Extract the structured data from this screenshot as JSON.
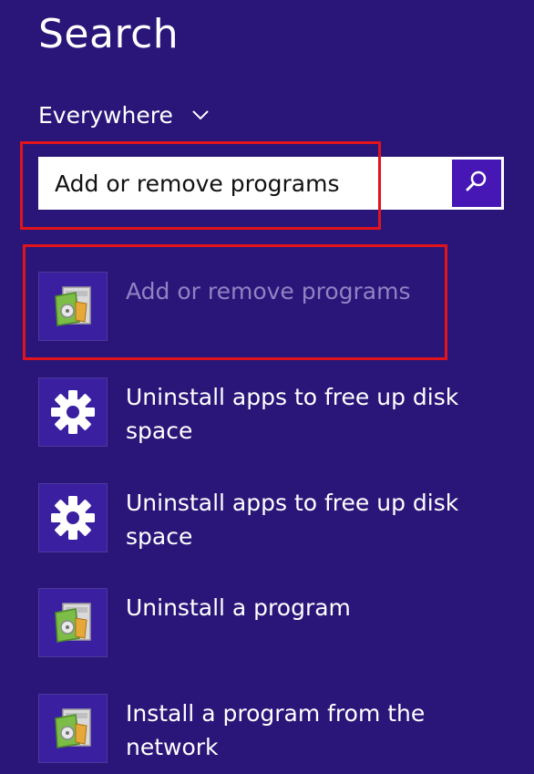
{
  "header": {
    "title": "Search"
  },
  "scope": {
    "label": "Everywhere"
  },
  "search": {
    "value": "Add or remove programs"
  },
  "results": [
    {
      "label": "Add or remove programs",
      "icon": "program-installer-icon",
      "selected": true
    },
    {
      "label": "Uninstall apps to free up disk space",
      "icon": "gear-icon",
      "selected": false
    },
    {
      "label": "Uninstall apps to free up disk space",
      "icon": "gear-icon",
      "selected": false
    },
    {
      "label": "Uninstall a program",
      "icon": "program-installer-icon",
      "selected": false
    },
    {
      "label": "Install a program from the network",
      "icon": "program-installer-icon",
      "selected": false
    }
  ],
  "colors": {
    "background": "#2a1679",
    "search_button": "#4617b4",
    "highlight": "#e1141b",
    "selected_text": "#8f83c4"
  }
}
